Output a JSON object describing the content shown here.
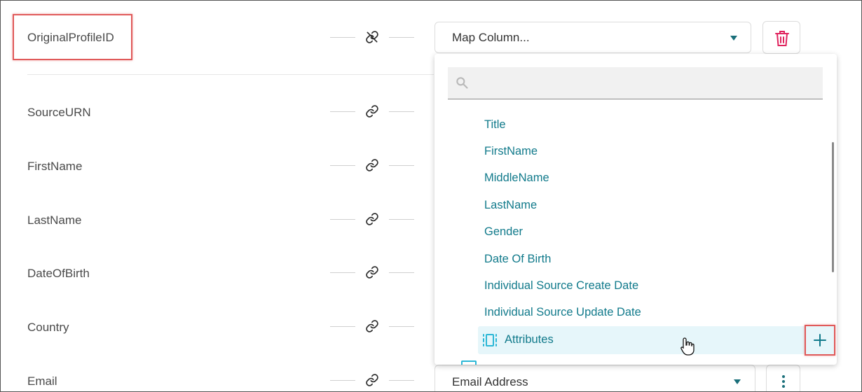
{
  "fields": [
    {
      "label": "OriginalProfileID"
    },
    {
      "label": "SourceURN"
    },
    {
      "label": "FirstName"
    },
    {
      "label": "LastName"
    },
    {
      "label": "DateOfBirth"
    },
    {
      "label": "Country"
    },
    {
      "label": "Email"
    }
  ],
  "top_select": {
    "value": "Map Column..."
  },
  "bottom_select": {
    "value": "Email Address"
  },
  "dropdown": {
    "search_placeholder": "",
    "options": [
      {
        "label": "Title"
      },
      {
        "label": "FirstName"
      },
      {
        "label": "MiddleName"
      },
      {
        "label": "LastName"
      },
      {
        "label": "Gender"
      },
      {
        "label": "Date Of Birth"
      },
      {
        "label": "Individual Source Create Date"
      },
      {
        "label": "Individual Source Update Date"
      }
    ],
    "group": {
      "label": "Attributes",
      "icon": "attributes-icon",
      "action_icon": "plus-icon"
    },
    "next_group_partial": ""
  },
  "icons": {
    "link": "link-icon",
    "unlink": "unlink-icon",
    "delete": "trash-icon",
    "more": "more-vertical-icon",
    "search": "search-icon"
  },
  "colors": {
    "accent": "#117a8b",
    "highlight": "#e05a5a",
    "delete": "#e0245e",
    "selected_bg": "#e6f6fa"
  }
}
